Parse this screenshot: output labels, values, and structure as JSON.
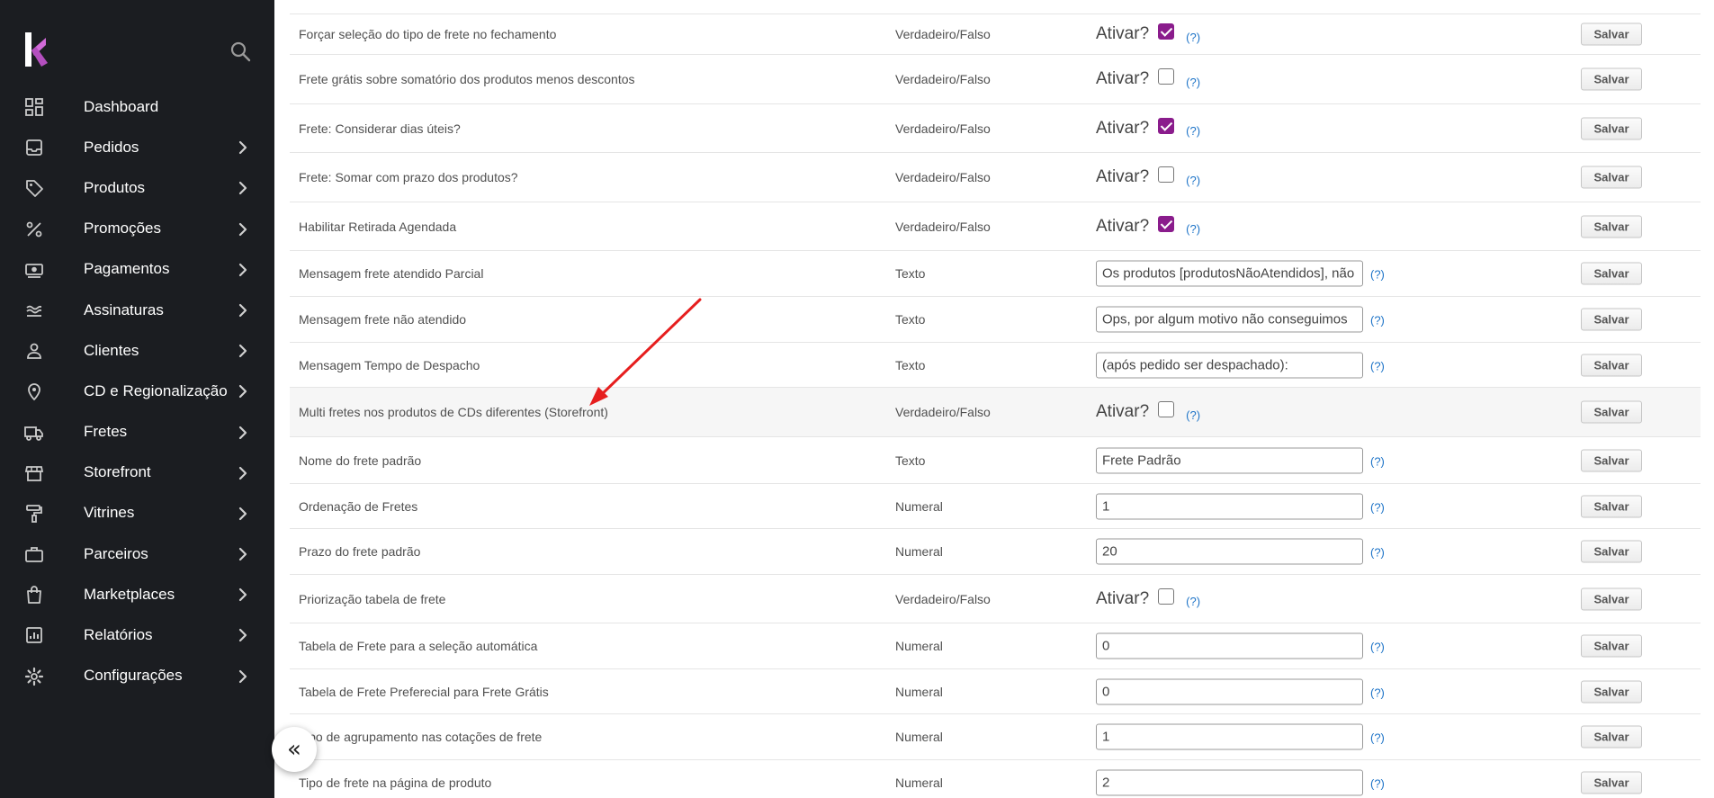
{
  "sidebar": {
    "items": [
      {
        "label": "Dashboard",
        "icon": "dashboard-icon",
        "has_children": false
      },
      {
        "label": "Pedidos",
        "icon": "inbox-icon",
        "has_children": true
      },
      {
        "label": "Produtos",
        "icon": "tag-icon",
        "has_children": true
      },
      {
        "label": "Promoções",
        "icon": "percent-icon",
        "has_children": true
      },
      {
        "label": "Pagamentos",
        "icon": "money-icon",
        "has_children": true
      },
      {
        "label": "Assinaturas",
        "icon": "waves-icon",
        "has_children": true
      },
      {
        "label": "Clientes",
        "icon": "user-icon",
        "has_children": true
      },
      {
        "label": "CD e Regionalização",
        "icon": "location-pin-icon",
        "has_children": true
      },
      {
        "label": "Fretes",
        "icon": "truck-icon",
        "has_children": true
      },
      {
        "label": "Storefront",
        "icon": "store-icon",
        "has_children": true
      },
      {
        "label": "Vitrines",
        "icon": "paint-roller-icon",
        "has_children": true
      },
      {
        "label": "Parceiros",
        "icon": "briefcase-icon",
        "has_children": true
      },
      {
        "label": "Marketplaces",
        "icon": "shopping-bag-icon",
        "has_children": true
      },
      {
        "label": "Relatórios",
        "icon": "report-icon",
        "has_children": true
      },
      {
        "label": "Configurações",
        "icon": "gear-icon",
        "has_children": true
      }
    ]
  },
  "collapse_label": "«",
  "ativar_label": "Ativar?",
  "help_label": "(?)",
  "save_label": "Salvar",
  "accent_color": "#8a1c8c",
  "rows": [
    {
      "name": "Forçar seleção do tipo de frete no fechamento",
      "type": "Verdadeiro/Falso",
      "control": "checkbox",
      "checked": true,
      "height": 45
    },
    {
      "name": "Frete grátis sobre somatório dos produtos menos descontos",
      "type": "Verdadeiro/Falso",
      "control": "checkbox",
      "checked": false,
      "height": 55
    },
    {
      "name": "Frete: Considerar dias úteis?",
      "type": "Verdadeiro/Falso",
      "control": "checkbox",
      "checked": true,
      "height": 54
    },
    {
      "name": "Frete: Somar com prazo dos produtos?",
      "type": "Verdadeiro/Falso",
      "control": "checkbox",
      "checked": false,
      "height": 55
    },
    {
      "name": "Habilitar Retirada Agendada",
      "type": "Verdadeiro/Falso",
      "control": "checkbox",
      "checked": true,
      "height": 54
    },
    {
      "name": "Mensagem frete atendido Parcial",
      "type": "Texto",
      "control": "text",
      "value": "Os produtos [produtosNãoAtendidos], não",
      "height": 51
    },
    {
      "name": "Mensagem frete não atendido",
      "type": "Texto",
      "control": "text",
      "value": "Ops, por algum motivo não conseguimos",
      "height": 51
    },
    {
      "name": "Mensagem Tempo de Despacho",
      "type": "Texto",
      "control": "text",
      "value": "(após pedido ser despachado):",
      "height": 50
    },
    {
      "name": "Multi fretes nos produtos de CDs diferentes (Storefront)",
      "type": "Verdadeiro/Falso",
      "control": "checkbox",
      "checked": false,
      "height": 55,
      "highlight": true
    },
    {
      "name": "Nome do frete padrão",
      "type": "Texto",
      "control": "text",
      "value": "Frete Padrão",
      "height": 52
    },
    {
      "name": "Ordenação de Fretes",
      "type": "Numeral",
      "control": "text",
      "value": "1",
      "height": 50
    },
    {
      "name": "Prazo do frete padrão",
      "type": "Numeral",
      "control": "text",
      "value": "20",
      "height": 51
    },
    {
      "name": "Priorização tabela de frete",
      "type": "Verdadeiro/Falso",
      "control": "checkbox",
      "checked": false,
      "height": 54
    },
    {
      "name": "Tabela de Frete para a seleção automática",
      "type": "Numeral",
      "control": "text",
      "value": "0",
      "height": 51
    },
    {
      "name": "Tabela de Frete Preferecial para Frete Grátis",
      "type": "Numeral",
      "control": "text",
      "value": "0",
      "height": 50
    },
    {
      "name": "Tipo de agrupamento nas cotações de frete",
      "type": "Numeral",
      "control": "text",
      "value": "1",
      "height": 51
    },
    {
      "name": "Tipo de frete na página de produto",
      "type": "Numeral",
      "control": "text",
      "value": "2",
      "height": 51
    }
  ]
}
